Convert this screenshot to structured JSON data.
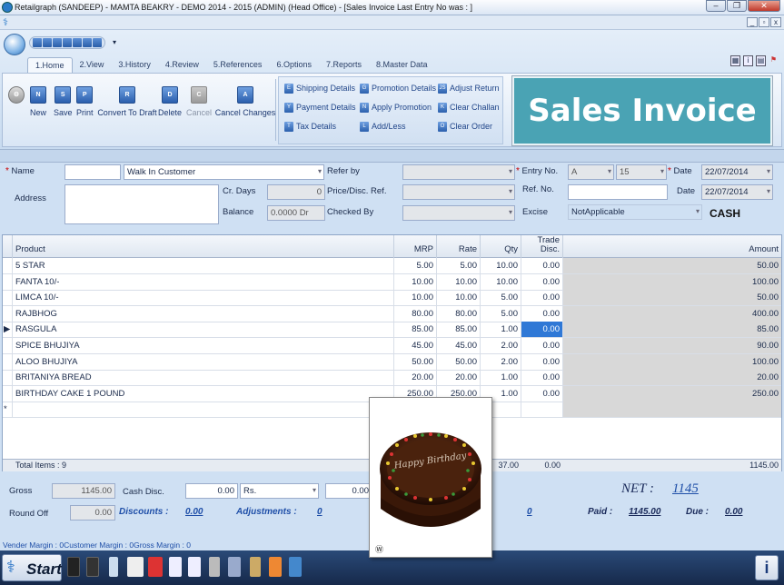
{
  "window": {
    "title": "Retailgraph (SANDEEP) - MAMTA BEAKRY - DEMO                    2014 - 2015 (ADMIN) (Head Office)  - [Sales Invoice     Last Entry No was : ]"
  },
  "ribbon": {
    "tabs": [
      "1.Home",
      "2.View",
      "3.History",
      "4.Review",
      "5.References",
      "6.Options",
      "7.Reports",
      "8.Master Data"
    ],
    "big_buttons": [
      {
        "label": "New",
        "icon": "N",
        "disabled": false
      },
      {
        "label": "Save",
        "icon": "S",
        "disabled": false
      },
      {
        "label": "Print",
        "icon": "P",
        "disabled": false
      },
      {
        "label": "Convert To Draft",
        "icon": "R",
        "disabled": false
      },
      {
        "label": "Delete",
        "icon": "D",
        "disabled": false
      },
      {
        "label": "Cancel",
        "icon": "C",
        "disabled": true
      },
      {
        "label": "Cancel Changes",
        "icon": "A",
        "disabled": false
      }
    ],
    "small_buttons": [
      {
        "label": "Shipping Details",
        "icon": "E"
      },
      {
        "label": "Payment Details",
        "icon": "Y"
      },
      {
        "label": "Tax Details",
        "icon": "T"
      },
      {
        "label": "Promotion Details",
        "icon": "G"
      },
      {
        "label": "Apply Promotion",
        "icon": "N"
      },
      {
        "label": "Add/Less",
        "icon": "L"
      },
      {
        "label": "Adjust Return",
        "icon": "JS"
      },
      {
        "label": "Clear Challan",
        "icon": "K"
      },
      {
        "label": "Clear Order",
        "icon": "O"
      }
    ]
  },
  "banner": {
    "text": "Sales Invoice"
  },
  "form": {
    "name_label": "Name",
    "name_code": "",
    "name_value": "Walk In Customer",
    "address_label": "Address",
    "address_value": "",
    "cr_days_label": "Cr. Days",
    "cr_days_value": "0",
    "balance_label": "Balance",
    "balance_value": "0.0000 Dr",
    "refer_by_label": "Refer by",
    "price_disc_label": "Price/Disc. Ref.",
    "checked_by_label": "Checked By",
    "entry_no_label": "Entry No.",
    "entry_series": "A",
    "entry_number": "15",
    "ref_no_label": "Ref. No.",
    "excise_label": "Excise",
    "excise_value": "NotApplicable",
    "date_label": "Date",
    "date_value": "22/07/2014",
    "date2_label": "Date",
    "date2_value": "22/07/2014",
    "payment_mode": "CASH"
  },
  "grid": {
    "columns": [
      "Product",
      "MRP",
      "Rate",
      "Qty",
      "Trade\nDisc.",
      "Amount"
    ],
    "rows": [
      {
        "product": "5 STAR",
        "mrp": "5.00",
        "rate": "5.00",
        "qty": "10.00",
        "disc": "0.00",
        "amount": "50.00"
      },
      {
        "product": "FANTA 10/-",
        "mrp": "10.00",
        "rate": "10.00",
        "qty": "10.00",
        "disc": "0.00",
        "amount": "100.00"
      },
      {
        "product": "LIMCA 10/-",
        "mrp": "10.00",
        "rate": "10.00",
        "qty": "5.00",
        "disc": "0.00",
        "amount": "50.00"
      },
      {
        "product": "RAJBHOG",
        "mrp": "80.00",
        "rate": "80.00",
        "qty": "5.00",
        "disc": "0.00",
        "amount": "400.00"
      },
      {
        "product": "RASGULA",
        "mrp": "85.00",
        "rate": "85.00",
        "qty": "1.00",
        "disc": "0.00",
        "amount": "85.00"
      },
      {
        "product": "SPICE BHUJIYA",
        "mrp": "45.00",
        "rate": "45.00",
        "qty": "2.00",
        "disc": "0.00",
        "amount": "90.00"
      },
      {
        "product": "ALOO BHUJIYA",
        "mrp": "50.00",
        "rate": "50.00",
        "qty": "2.00",
        "disc": "0.00",
        "amount": "100.00"
      },
      {
        "product": "BRITANIYA BREAD",
        "mrp": "20.00",
        "rate": "20.00",
        "qty": "1.00",
        "disc": "0.00",
        "amount": "20.00"
      },
      {
        "product": "BIRTHDAY CAKE 1 POUND",
        "mrp": "250.00",
        "rate": "250.00",
        "qty": "1.00",
        "disc": "0.00",
        "amount": "250.00"
      }
    ],
    "new_row_marker": "*",
    "footer": {
      "total_items": "Total Items : 9",
      "qty_total": "37.00",
      "disc_total": "0.00",
      "amount_total": "1145.00"
    }
  },
  "totals": {
    "gross_label": "Gross",
    "gross_value": "1145.00",
    "round_off_label": "Round Off",
    "round_off_value": "0.00",
    "cash_disc_label": "Cash Disc.",
    "cash_disc_value": "0.00",
    "cash_disc_unit": "Rs.",
    "cash_disc_extra": "0.00",
    "discounts_label": "Discounts :",
    "discounts_value": "0.00",
    "adjustments_label": "Adjustments :",
    "adjustments_value": "0",
    "hidden_value": "0",
    "net_label": "NET :",
    "net_value": "1145",
    "paid_label": "Paid :",
    "paid_value": "1145.00",
    "due_label": "Due :",
    "due_value": "0.00"
  },
  "status": {
    "text": "Vender Margin : 0Customer Margin : 0Gross Margin : 0"
  },
  "taskbar": {
    "start_label": "Start"
  },
  "popup": {
    "caption_text": "Happy Birthday",
    "corner_mark": "Ⓦ"
  },
  "colors": {
    "banner_bg": "#4aa3b4",
    "selection": "#2f78d6",
    "taskbar": "#1c3559"
  }
}
